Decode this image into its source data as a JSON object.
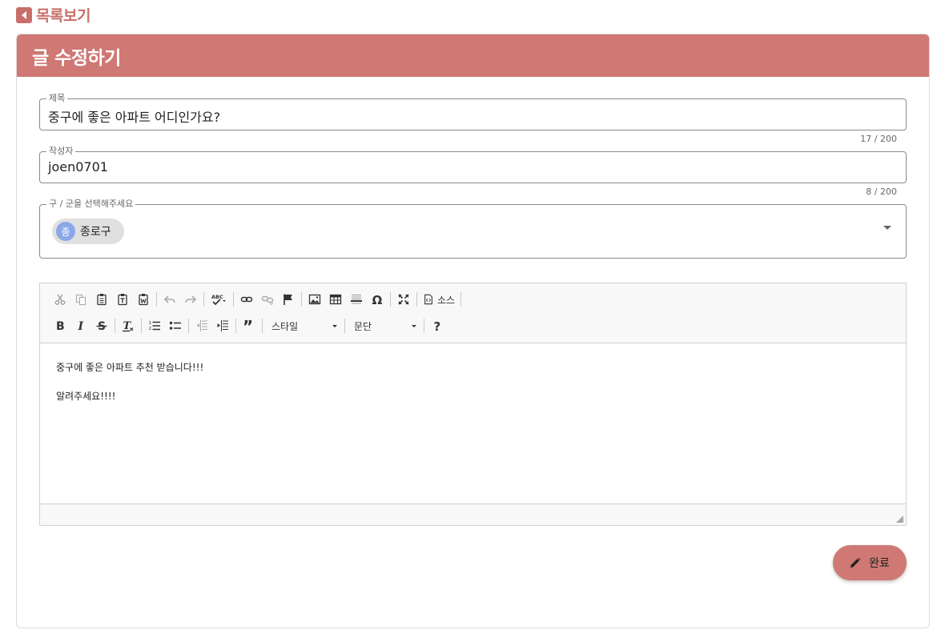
{
  "back_link": {
    "label": "목록보기",
    "icon": "caret-left-icon"
  },
  "card": {
    "title": "글 수정하기",
    "header_color": "#cf7874"
  },
  "form": {
    "title_field": {
      "legend": "제목",
      "value": "중구에 좋은 아파트 어디인가요?",
      "counter": "17 / 200"
    },
    "author_field": {
      "legend": "작성자",
      "value": "joen0701",
      "counter": "8 / 200"
    },
    "district_select": {
      "legend": "구 / 군을 선택해주세요",
      "selected": [
        {
          "avatar": "종",
          "label": "종로구"
        }
      ]
    }
  },
  "editor": {
    "toolbar": {
      "styles_combo": "스타일",
      "format_combo": "문단",
      "source_label": "소스",
      "row1_icons": [
        "cut-icon",
        "copy-icon",
        "paste-icon",
        "paste-text-icon",
        "paste-word-icon",
        "undo-icon",
        "redo-icon",
        "spellcheck-icon",
        "link-icon",
        "unlink-icon",
        "anchor-icon",
        "image-icon",
        "table-icon",
        "horizontal-rule-icon",
        "special-char-icon",
        "maximize-icon",
        "source-icon"
      ],
      "row2_icons": [
        "bold-icon",
        "italic-icon",
        "strike-icon",
        "remove-format-icon",
        "numbered-list-icon",
        "bulleted-list-icon",
        "outdent-icon",
        "indent-icon",
        "blockquote-icon",
        "help-icon"
      ]
    },
    "content": [
      "중구에 좋은 아파트 추천 받습니다!!!",
      "알려주세요!!!!"
    ]
  },
  "submit": {
    "label": "완료",
    "icon": "pencil-icon"
  }
}
